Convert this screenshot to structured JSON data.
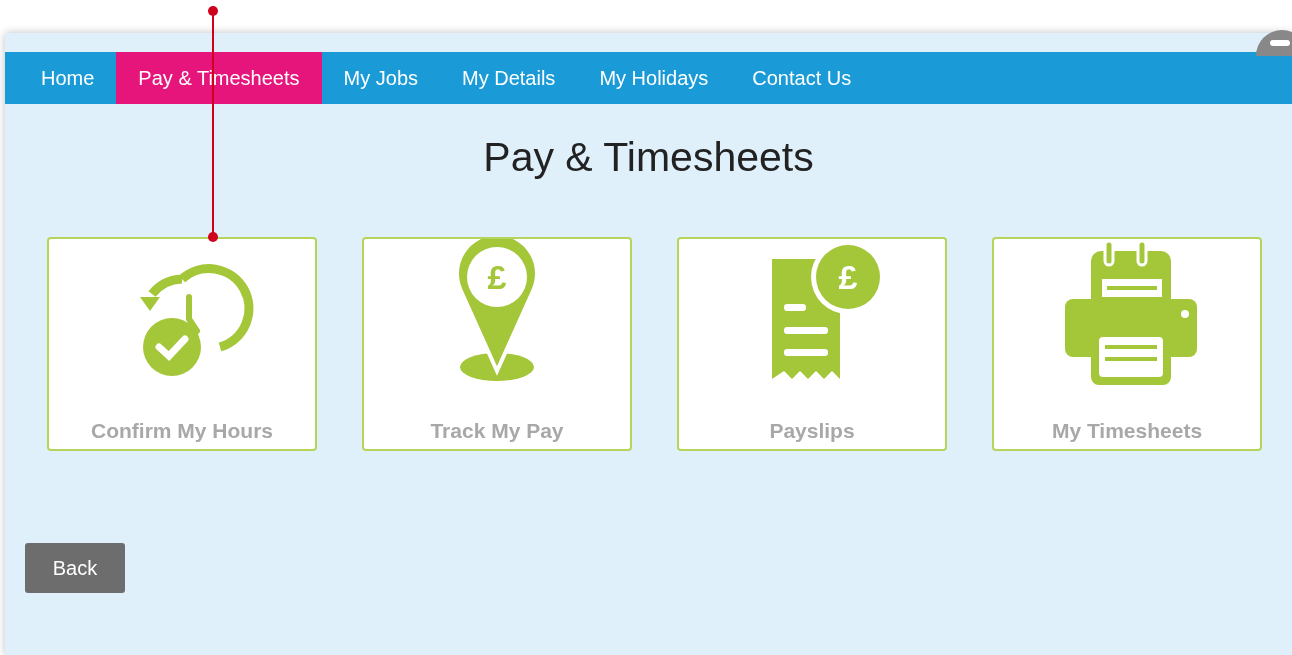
{
  "nav": [
    {
      "label": "Home",
      "selected": false
    },
    {
      "label": "Pay & Timesheets",
      "selected": true
    },
    {
      "label": "My Jobs",
      "selected": false
    },
    {
      "label": "My Details",
      "selected": false
    },
    {
      "label": "My Holidays",
      "selected": false
    },
    {
      "label": "Contact Us",
      "selected": false
    }
  ],
  "page_title": "Pay & Timesheets",
  "tiles": [
    {
      "kind": "clock",
      "label": "Confirm My Hours"
    },
    {
      "kind": "pin",
      "symbol": "£",
      "label": "Track My Pay"
    },
    {
      "kind": "receipt",
      "symbol": "£",
      "label": "Payslips"
    },
    {
      "kind": "printer",
      "label": "My Timesheets"
    }
  ],
  "back_button": "Back"
}
